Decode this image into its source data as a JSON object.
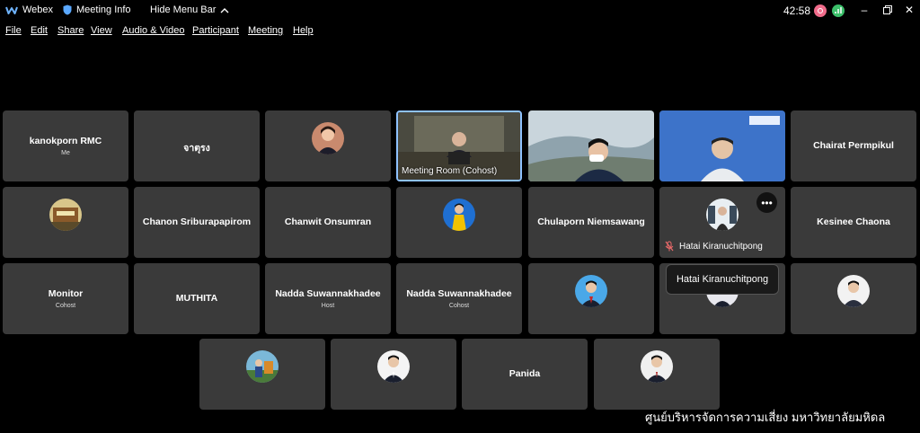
{
  "titlebar": {
    "app_name": "Webex",
    "meeting_info": "Meeting Info",
    "hide_menu_bar": "Hide Menu Bar",
    "timer": "42:58"
  },
  "menu": [
    "File",
    "Edit",
    "Share",
    "View",
    "Audio & Video",
    "Participant",
    "Meeting",
    "Help"
  ],
  "tiles": {
    "t1": {
      "name": "kanokporn RMC",
      "role": "Me"
    },
    "t2": {
      "name": "จาตุรง"
    },
    "t4": {
      "label": "Meeting Room (Cohost)"
    },
    "t7": {
      "name": "Chairat Permpikul"
    },
    "t9": {
      "name": "Chanon Sriburapapirom"
    },
    "t10": {
      "name": "Chanwit Onsumran"
    },
    "t12": {
      "name": "Chulaporn Niemsawang"
    },
    "t13": {
      "label": "Hatai Kiranuchitpong"
    },
    "t14": {
      "name": "Kesinee Chaona"
    },
    "t15": {
      "name": "Monitor",
      "role": "Cohost"
    },
    "t16": {
      "name": "MUTHITA"
    },
    "t17": {
      "name": "Nadda Suwannakhadee",
      "role": "Host"
    },
    "t18": {
      "name": "Nadda Suwannakhadee",
      "role": "Cohost"
    },
    "t24": {
      "name": "Panida"
    }
  },
  "tooltip": "Hatai Kiranuchitpong",
  "watermark": "ศูนย์บริหารจัดการความเสี่ยง มหาวิทยาลัยมหิดล",
  "colors": {
    "tile_bg": "#3a3a3a",
    "active_border": "#8ec2ff",
    "background": "#000000"
  }
}
